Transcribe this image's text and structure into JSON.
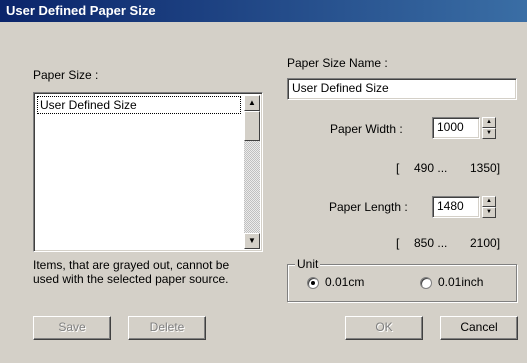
{
  "window": {
    "title": "User Defined Paper Size"
  },
  "paper_size": {
    "label": "Paper Size :",
    "items": [
      "User Defined Size"
    ],
    "note": [
      "Items, that are grayed out, cannot be",
      "used with the selected paper source."
    ]
  },
  "paper_size_name": {
    "label": "Paper Size Name :",
    "value": "User Defined Size"
  },
  "paper_width": {
    "label": "Paper Width :",
    "value": "1000",
    "range_open": "[",
    "range_min": "490 ...",
    "range_max": "1350]"
  },
  "paper_length": {
    "label": "Paper Length :",
    "value": "1480",
    "range_open": "[",
    "range_min": "850 ...",
    "range_max": "2100]"
  },
  "unit": {
    "legend": "Unit",
    "options": [
      {
        "label": "0.01cm",
        "selected": true
      },
      {
        "label": "0.01inch",
        "selected": false
      }
    ]
  },
  "buttons": {
    "save": "Save",
    "delete": "Delete",
    "ok": "OK",
    "cancel": "Cancel"
  },
  "icons": {
    "scroll_up": "▲",
    "scroll_down": "▼",
    "spin_up": "▲",
    "spin_down": "▼"
  }
}
